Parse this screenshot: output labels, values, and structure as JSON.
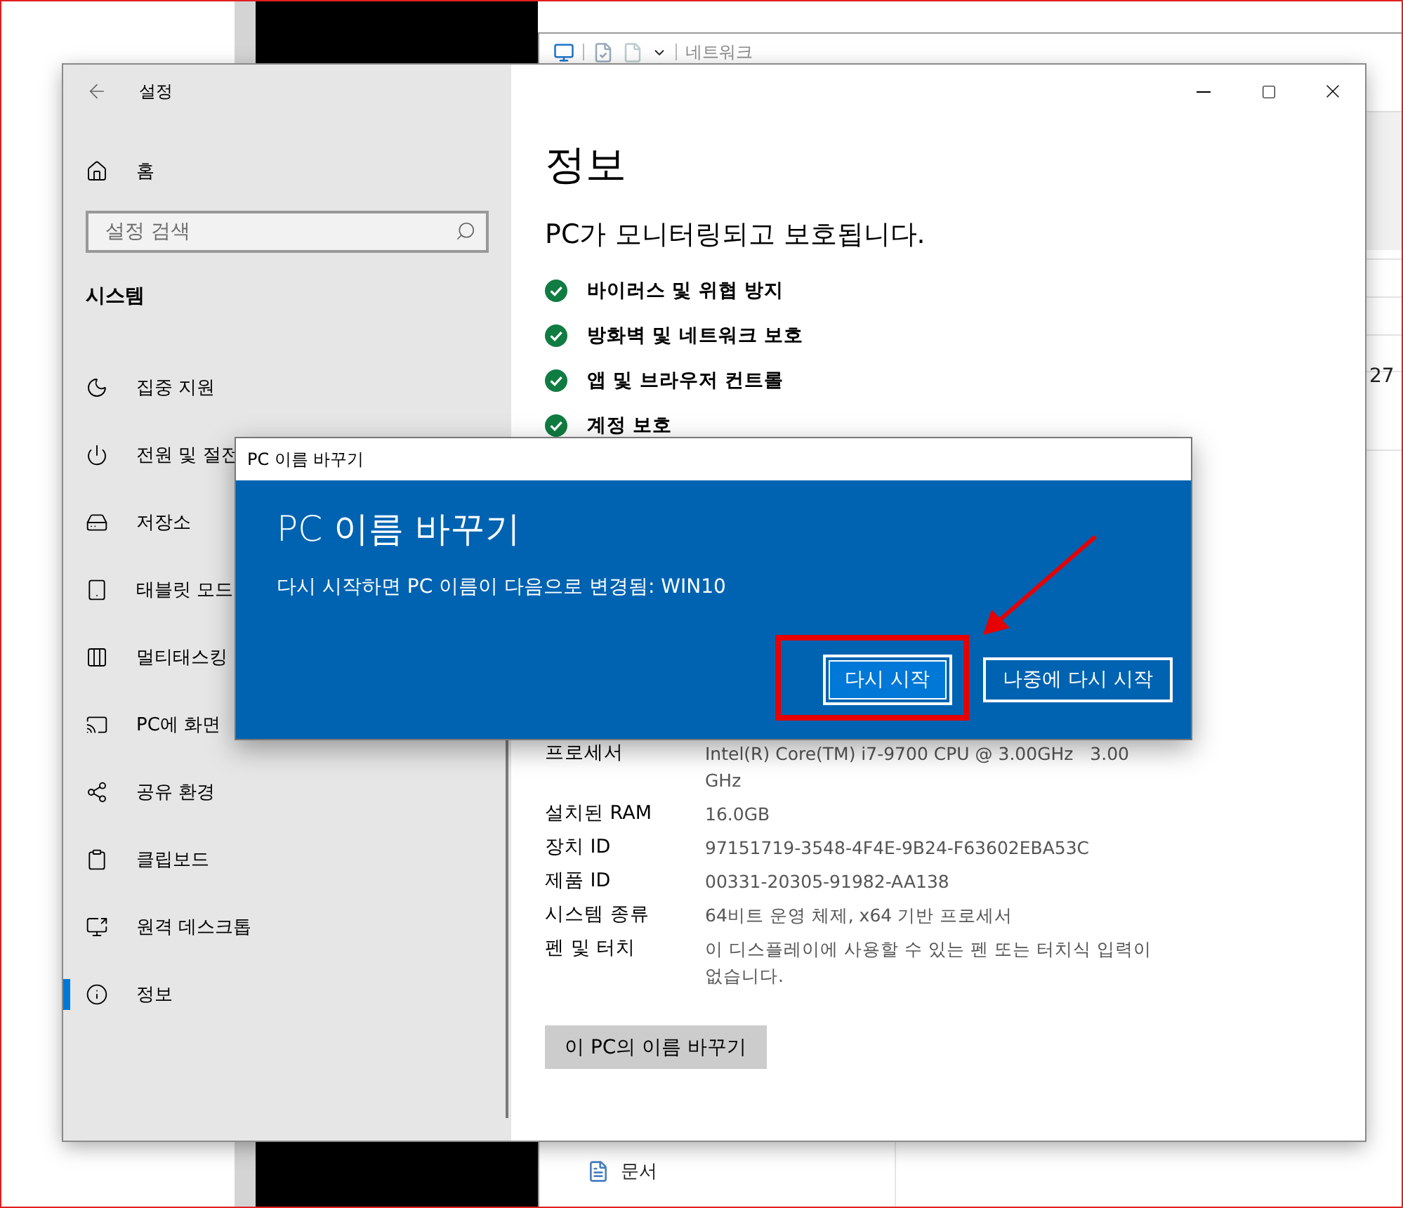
{
  "explorer": {
    "location": "네트워크",
    "partial_text": "27",
    "nav_items": [
      {
        "label": "문서"
      }
    ]
  },
  "settings": {
    "title": "설정",
    "sidebar": {
      "home": "홈",
      "search": {
        "placeholder": "설정 검색"
      },
      "section": "시스템",
      "items": [
        {
          "label": "집중 지원",
          "selected": false
        },
        {
          "label": "전원 및 절전",
          "selected": false
        },
        {
          "label": "저장소",
          "selected": false
        },
        {
          "label": "태블릿 모드",
          "selected": false
        },
        {
          "label": "멀티태스킹",
          "selected": false
        },
        {
          "label": "PC에 화면",
          "selected": false
        },
        {
          "label": "공유 환경",
          "selected": false
        },
        {
          "label": "클립보드",
          "selected": false
        },
        {
          "label": "원격 데스크톱",
          "selected": false
        },
        {
          "label": "정보",
          "selected": true
        }
      ]
    },
    "content": {
      "heading": "정보",
      "protection_title": "PC가 모니터링되고 보호됩니다.",
      "protection_items": [
        "바이러스 및 위협 방지",
        "방화벽 및 네트워크 보호",
        "앱 및 브라우저 컨트롤",
        "계정 보호"
      ],
      "specs": [
        {
          "label": "프로세서",
          "value": "Intel(R) Core(TM) i7-9700 CPU @ 3.00GHz   3.00 GHz"
        },
        {
          "label": "설치된 RAM",
          "value": "16.0GB"
        },
        {
          "label": "장치 ID",
          "value": "97151719-3548-4F4E-9B24-F63602EBA53C"
        },
        {
          "label": "제품 ID",
          "value": "00331-20305-91982-AA138"
        },
        {
          "label": "시스템 종류",
          "value": "64비트 운영 체제, x64 기반 프로세서"
        },
        {
          "label": "펜 및 터치",
          "value": "이 디스플레이에 사용할 수 있는 펜 또는 터치식 입력이 없습니다."
        }
      ],
      "rename_button": "이 PC의 이름 바꾸기"
    }
  },
  "dialog": {
    "window_title": "PC 이름 바꾸기",
    "title": "PC 이름 바꾸기",
    "message": "다시 시작하면 PC 이름이 다음으로 변경됨: WIN10",
    "buttons": [
      {
        "label": "다시 시작",
        "focused": true
      },
      {
        "label": "나중에 다시 시작",
        "focused": false
      }
    ]
  }
}
